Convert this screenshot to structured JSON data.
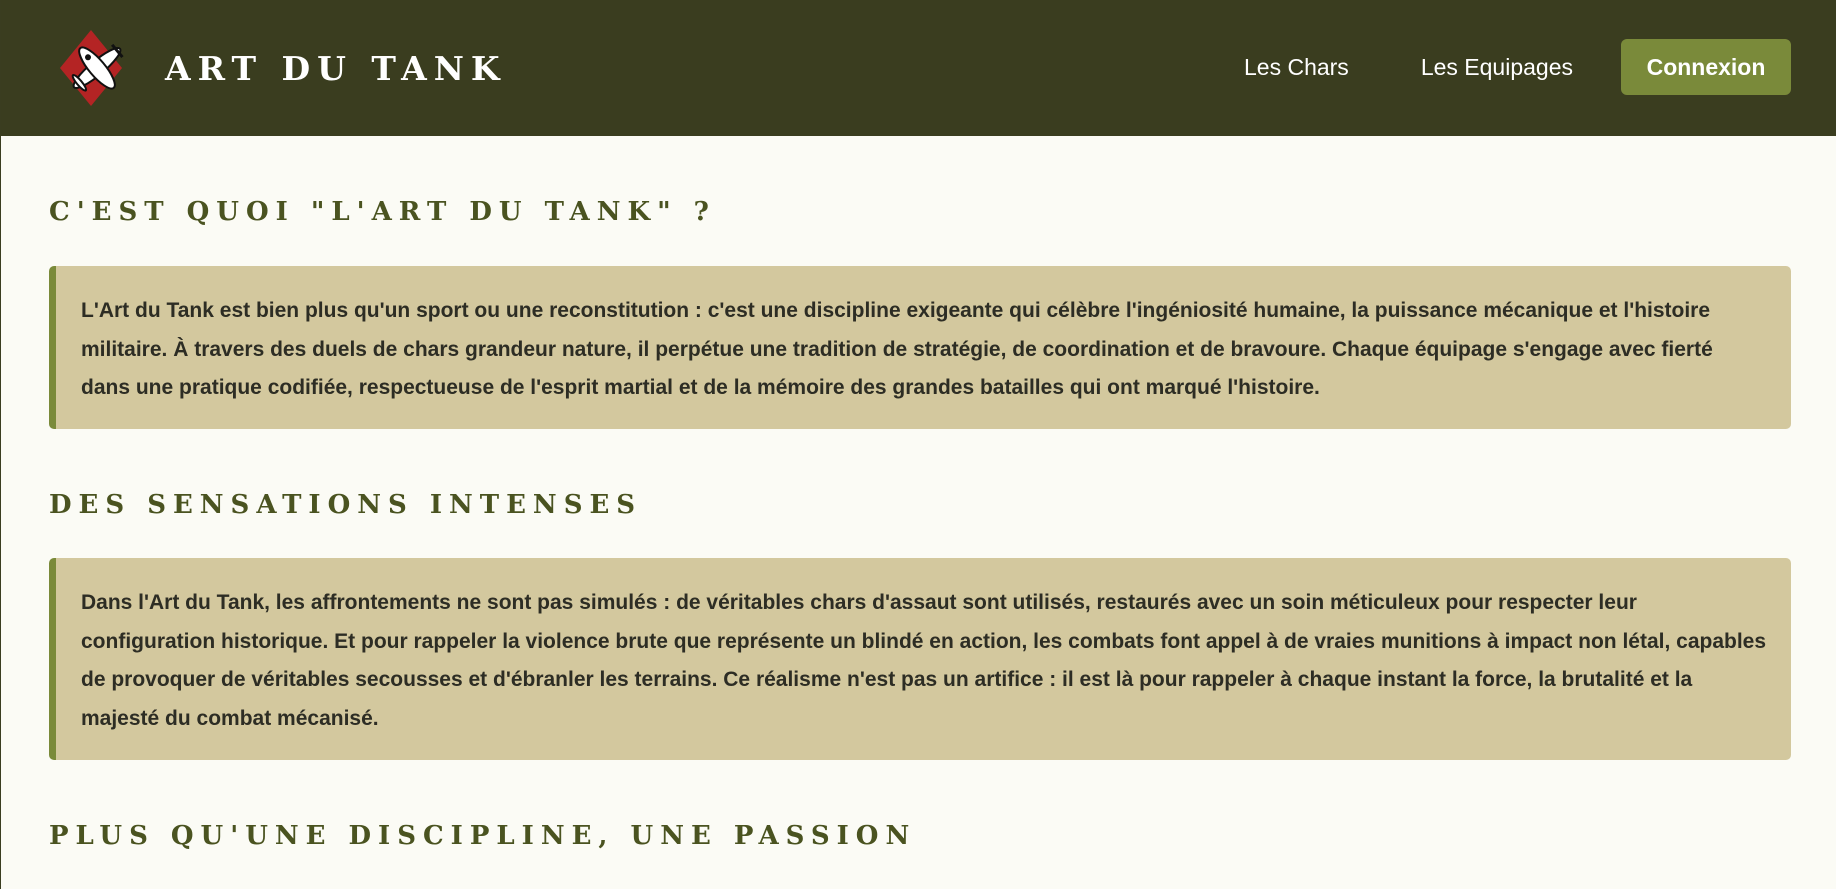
{
  "header": {
    "brand_title": "ART DU TANK",
    "logo_icon": "plane-diamond-logo-icon",
    "nav": [
      {
        "label": "Les Chars"
      },
      {
        "label": "Les Equipages"
      }
    ],
    "login_label": "Connexion"
  },
  "sections": [
    {
      "title": "C'est quoi \"L'Art du Tank\" ?",
      "text": "L'Art du Tank est bien plus qu'un sport ou une reconstitution : c'est une discipline exigeante qui célèbre l'ingéniosité humaine, la puissance mécanique et l'histoire militaire. À travers des duels de chars grandeur nature, il perpétue une tradition de stratégie, de coordination et de bravoure. Chaque équipage s'engage avec fierté dans une pratique codifiée, respectueuse de l'esprit martial et de la mémoire des grandes batailles qui ont marqué l'histoire."
    },
    {
      "title": "Des sensations intenses",
      "text": "Dans l'Art du Tank, les affrontements ne sont pas simulés : de véritables chars d'assaut sont utilisés, restaurés avec un soin méticuleux pour respecter leur configuration historique. Et pour rappeler la violence brute que représente un blindé en action, les combats font appel à de vraies munitions à impact non létal, capables de provoquer de véritables secousses et d'ébranler les terrains. Ce réalisme n'est pas un artifice : il est là pour rappeler à chaque instant la force, la brutalité et la majesté du combat mécanisé."
    },
    {
      "title": "Plus qu'une discipline, une passion"
    }
  ],
  "colors": {
    "header_bg": "#3a3d1f",
    "accent": "#7a8a3a",
    "card_bg": "#d3c89e",
    "title": "#4a5320"
  }
}
